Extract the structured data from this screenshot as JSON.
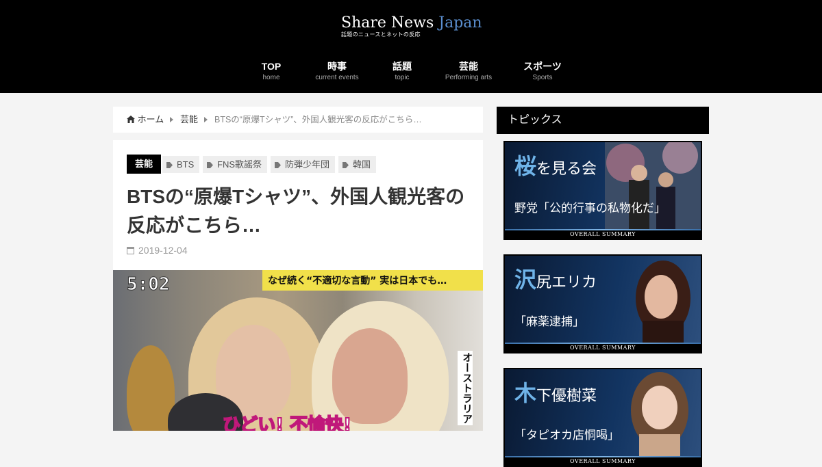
{
  "site": {
    "logo_main": "Share News ",
    "logo_accent": "Japan",
    "logo_tagline": "話題のニュースとネットの反応"
  },
  "nav": [
    {
      "label": "TOP",
      "sub": "home"
    },
    {
      "label": "時事",
      "sub": "current events"
    },
    {
      "label": "話題",
      "sub": "topic"
    },
    {
      "label": "芸能",
      "sub": "Performing arts"
    },
    {
      "label": "スポーツ",
      "sub": "Sports"
    }
  ],
  "breadcrumb": {
    "home": "ホーム",
    "category": "芸能",
    "current": "BTSの“原爆Tシャツ”、外国人観光客の反応がこちら…"
  },
  "article": {
    "category": "芸能",
    "tags": [
      "BTS",
      "FNS歌謡祭",
      "防弾少年団",
      "韓国"
    ],
    "title": "BTSの“原爆Tシャツ”、外国人観光客の反応がこちら…",
    "date": "2019-12-04",
    "image": {
      "time": "5:02",
      "banner": "なぜ続く“不適切な言動” 実は日本でも…",
      "vertical_label": "オーストラリア",
      "caption": "ひどい! 不愉快!"
    }
  },
  "sidebar": {
    "heading": "トピックス",
    "cards": [
      {
        "big": "桜",
        "rest": "を見る会",
        "sub": "野党「公的行事の私物化だ」",
        "footer": "OVERALL SUMMARY"
      },
      {
        "big": "沢",
        "rest": "尻エリカ",
        "sub": "「麻薬逮捕」",
        "footer": "OVERALL SUMMARY"
      },
      {
        "big": "木",
        "rest": "下優樹菜",
        "sub": "「タピオカ店恫喝」",
        "footer": "OVERALL SUMMARY"
      }
    ]
  },
  "colors": {
    "header_bg": "#000000",
    "logo_accent": "#5b8fd0",
    "page_bg": "#f4f4f4",
    "card_bg": "#0b1f3a",
    "card_accent": "#6fb3e8"
  }
}
